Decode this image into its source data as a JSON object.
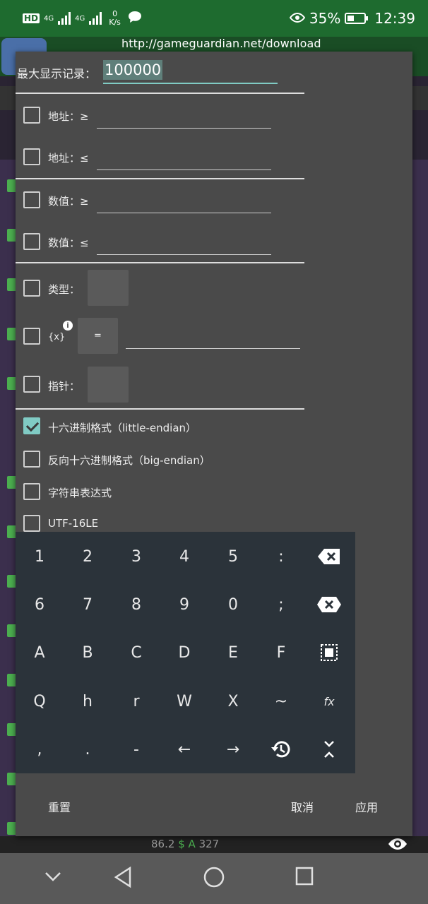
{
  "status": {
    "hd": "HD",
    "net1": "4G",
    "net2": "4G",
    "speed_value": "0",
    "speed_unit": "K/s",
    "battery_percent": "35%",
    "time": "12:39"
  },
  "url_overlay": "http://gameguardian.net/download",
  "dialog": {
    "max_records_label": "最大显示记录：",
    "max_records_value": "100000",
    "addr_ge_label": "地址：≥",
    "addr_le_label": "地址：≤",
    "value_ge_label": "数值：≥",
    "value_le_label": "数值：≤",
    "type_label": "类型：",
    "expr_label": "{x}",
    "expr_info": "i",
    "expr_op": "=",
    "pointer_label": "指针：",
    "hex_le_label": "十六进制格式（little-endian）",
    "hex_be_label": "反向十六进制格式（big-endian）",
    "string_expr_label": "字符串表达式",
    "utf16_label": "UTF-16LE",
    "reset_label": "重置",
    "cancel_label": "取消",
    "apply_label": "应用"
  },
  "keypad": {
    "rows": [
      [
        "1",
        "2",
        "3",
        "4",
        "5",
        ":"
      ],
      [
        "6",
        "7",
        "8",
        "9",
        "0",
        ";"
      ],
      [
        "A",
        "B",
        "C",
        "D",
        "E",
        "F"
      ],
      [
        "Q",
        "h",
        "r",
        "W",
        "X",
        "~"
      ],
      [
        ",",
        ".",
        "-",
        "←",
        "→"
      ]
    ],
    "fx_label": "fx"
  },
  "background": {
    "stat_value": "86.2",
    "stat_dollar": "$",
    "stat_a": "A",
    "stat_count": "327"
  }
}
